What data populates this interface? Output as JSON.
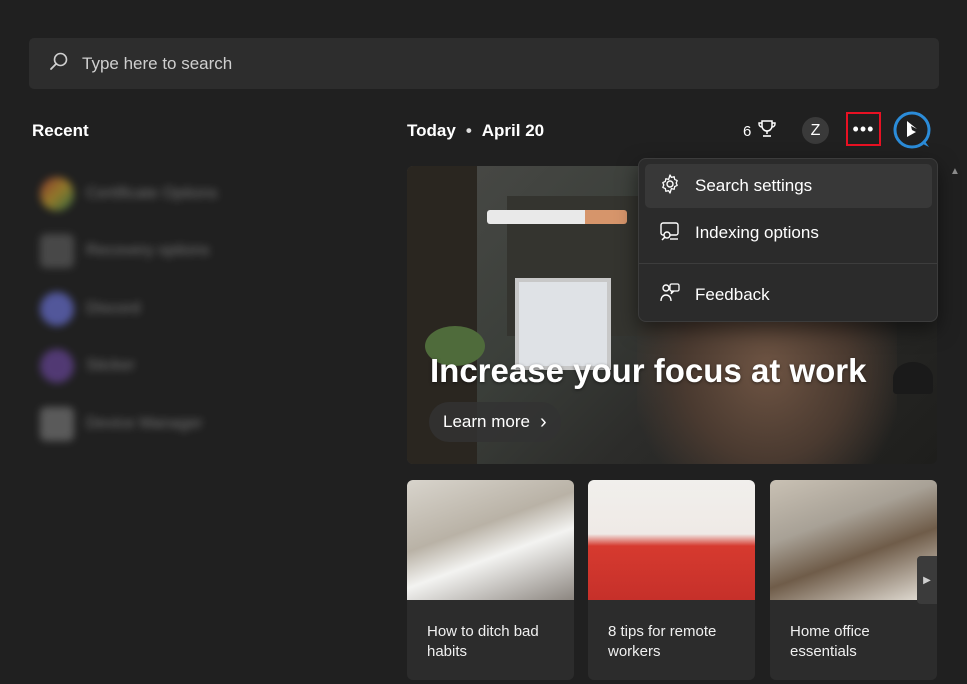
{
  "search": {
    "placeholder": "Type here to search"
  },
  "recent": {
    "title": "Recent",
    "items": [
      {
        "label": "Certificate Options"
      },
      {
        "label": "Recovery options"
      },
      {
        "label": "Discord"
      },
      {
        "label": "Sticker"
      },
      {
        "label": "Device Manager"
      }
    ]
  },
  "header": {
    "today_label": "Today",
    "separator": "•",
    "date": "April 20",
    "points": "6",
    "avatar_letter": "Z",
    "more_label": "•••"
  },
  "hero": {
    "title": "Increase your focus at work",
    "button_label": "Learn more",
    "button_chevron": "›"
  },
  "menu": {
    "items": [
      {
        "label": "Search settings",
        "icon": "gear-icon"
      },
      {
        "label": "Indexing options",
        "icon": "indexing-icon"
      },
      {
        "label": "Feedback",
        "icon": "feedback-icon"
      }
    ]
  },
  "cards": [
    {
      "title": "How to ditch bad habits"
    },
    {
      "title": "8 tips for remote workers"
    },
    {
      "title": "Home office essentials"
    }
  ],
  "card_next_glyph": "▶",
  "scroll_up_glyph": "▲",
  "colors": {
    "background": "#202020",
    "search_box": "#2d2d2d",
    "menu": "#2b2b2b",
    "highlight_border": "#e81123",
    "bing_blue": "#2b8cd9"
  }
}
